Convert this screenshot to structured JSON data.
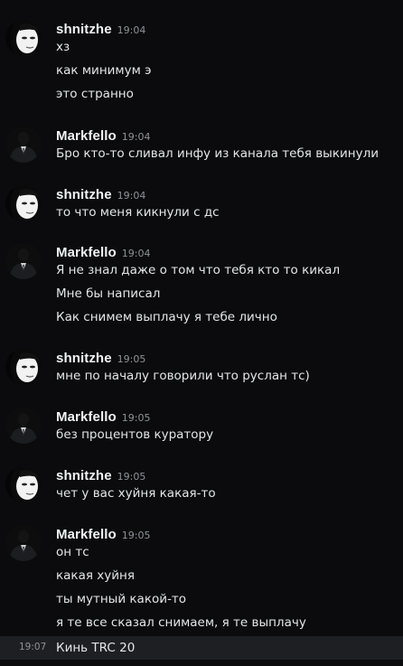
{
  "messages": [
    {
      "author": "shnitzhe",
      "time": "19:04",
      "avatar": "girl-face-icon",
      "lines": [
        "хз",
        "как минимум э",
        "это странно"
      ]
    },
    {
      "author": "Markfello",
      "time": "19:04",
      "avatar": "man-in-suit-icon",
      "lines": [
        "Бро кто-то сливал инфу из канала тебя выкинули"
      ]
    },
    {
      "author": "shnitzhe",
      "time": "19:04",
      "avatar": "girl-face-icon",
      "lines": [
        "то что меня кикнули с дс"
      ]
    },
    {
      "author": "Markfello",
      "time": "19:04",
      "avatar": "man-in-suit-icon",
      "lines": [
        "Я не знал даже о том что тебя кто то кикал",
        "Мне бы написал",
        "Как снимем выплачу я тебе лично"
      ]
    },
    {
      "author": "shnitzhe",
      "time": "19:05",
      "avatar": "girl-face-icon",
      "lines": [
        "мне по началу говорили что руслан тс)"
      ]
    },
    {
      "author": "Markfello",
      "time": "19:05",
      "avatar": "man-in-suit-icon",
      "lines": [
        "без процентов куратору"
      ]
    },
    {
      "author": "shnitzhe",
      "time": "19:05",
      "avatar": "girl-face-icon",
      "lines": [
        "чет у вас хуйня какая-то"
      ]
    },
    {
      "author": "Markfello",
      "time": "19:05",
      "avatar": "man-in-suit-icon",
      "lines": [
        "он тс",
        "какая хуйня",
        "ты мутный какой-то",
        "я те все сказал снимаем, я те выплачу"
      ]
    }
  ],
  "hovered_message": {
    "time": "19:07",
    "text": "Кинь TRC 20"
  },
  "colors": {
    "background": "#0b0b0d",
    "hover_background": "#1e1f22",
    "username": "#f2f3f5",
    "timestamp": "#8e9297",
    "message_text": "#e3e5e8"
  }
}
